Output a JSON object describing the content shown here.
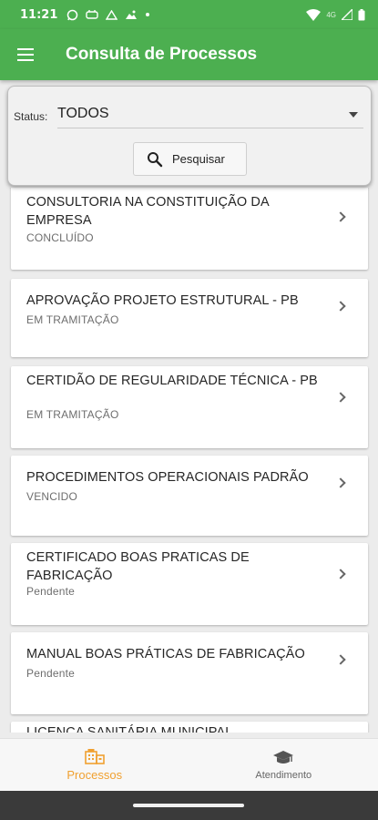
{
  "status_bar": {
    "time": "11:21",
    "network": "4G"
  },
  "app_bar": {
    "title": "Consulta de Processos"
  },
  "filter": {
    "status_label": "Status:",
    "status_value": "TODOS",
    "search_label": "Pesquisar"
  },
  "processes": [
    {
      "title": "CONSULTORIA NA CONSTITUIÇÃO DA EMPRESA",
      "status": "CONCLUÍDO"
    },
    {
      "title": "APROVAÇÃO PROJETO ESTRUTURAL - PB",
      "status": "EM TRAMITAÇÃO"
    },
    {
      "title": "CERTIDÃO DE REGULARIDADE TÉCNICA - PB",
      "status": "EM TRAMITAÇÃO"
    },
    {
      "title": "PROCEDIMENTOS OPERACIONAIS PADRÃO",
      "status": "VENCIDO"
    },
    {
      "title": "CERTIFICADO  BOAS PRATICAS DE FABRICAÇÃO",
      "status": "Pendente"
    },
    {
      "title": "MANUAL BOAS PRÁTICAS DE FABRICAÇÃO",
      "status": "Pendente"
    },
    {
      "title": "LICENÇA SANITÁRIA MUNICIPAL",
      "status": ""
    }
  ],
  "bottom_nav": {
    "processos": "Processos",
    "atendimento": "Atendimento"
  },
  "colors": {
    "primary": "#4caf50",
    "accent": "#f0a030"
  }
}
